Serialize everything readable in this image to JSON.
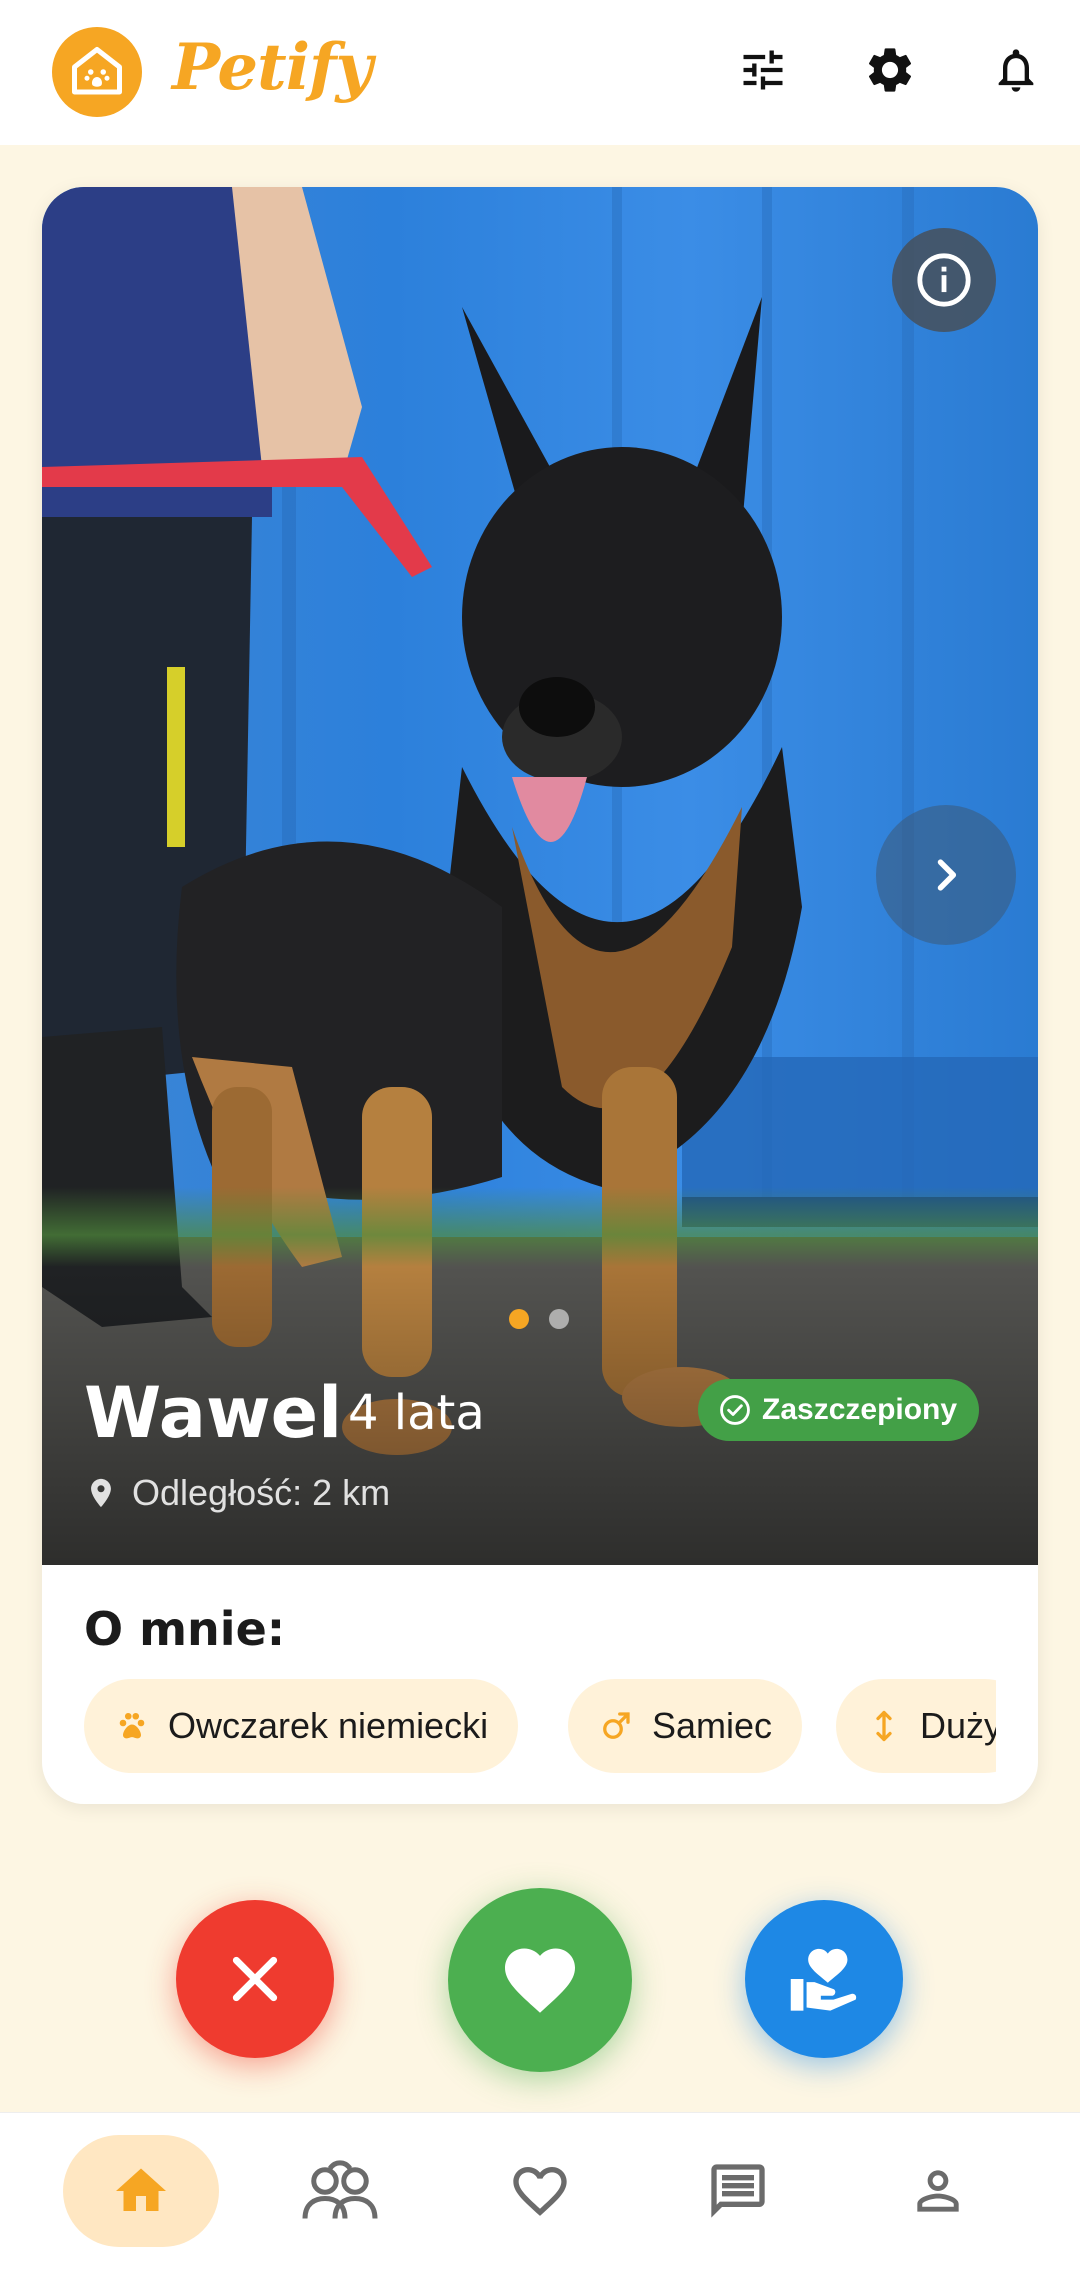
{
  "header": {
    "app_title": "Petify",
    "icons": [
      "filter-icon",
      "settings-icon",
      "notifications-icon"
    ]
  },
  "card": {
    "pet_name": "Wawel",
    "pet_age": "4 lata",
    "distance": "Odległość: 2 km",
    "vaccinated_badge": "Zaszczepiony",
    "photo_index": 1,
    "photo_count": 2,
    "about_title": "O mnie:",
    "chips": [
      {
        "label": "Owczarek niemiecki",
        "icon": "paw-icon"
      },
      {
        "label": "Samiec",
        "icon": "male-icon"
      },
      {
        "label": "Duży",
        "icon": "size-icon"
      }
    ]
  },
  "actions": [
    "reject-button",
    "like-button",
    "adopt-button"
  ],
  "bottom_nav": {
    "items": [
      "home",
      "community",
      "favorites",
      "messages",
      "profile"
    ],
    "active": "home"
  },
  "colors": {
    "accent": "#f6a623",
    "background": "#fdf6e3",
    "reject": "#ef3b2f",
    "like": "#4caf50",
    "adopt": "#1e88e5",
    "badge": "#43a047"
  }
}
